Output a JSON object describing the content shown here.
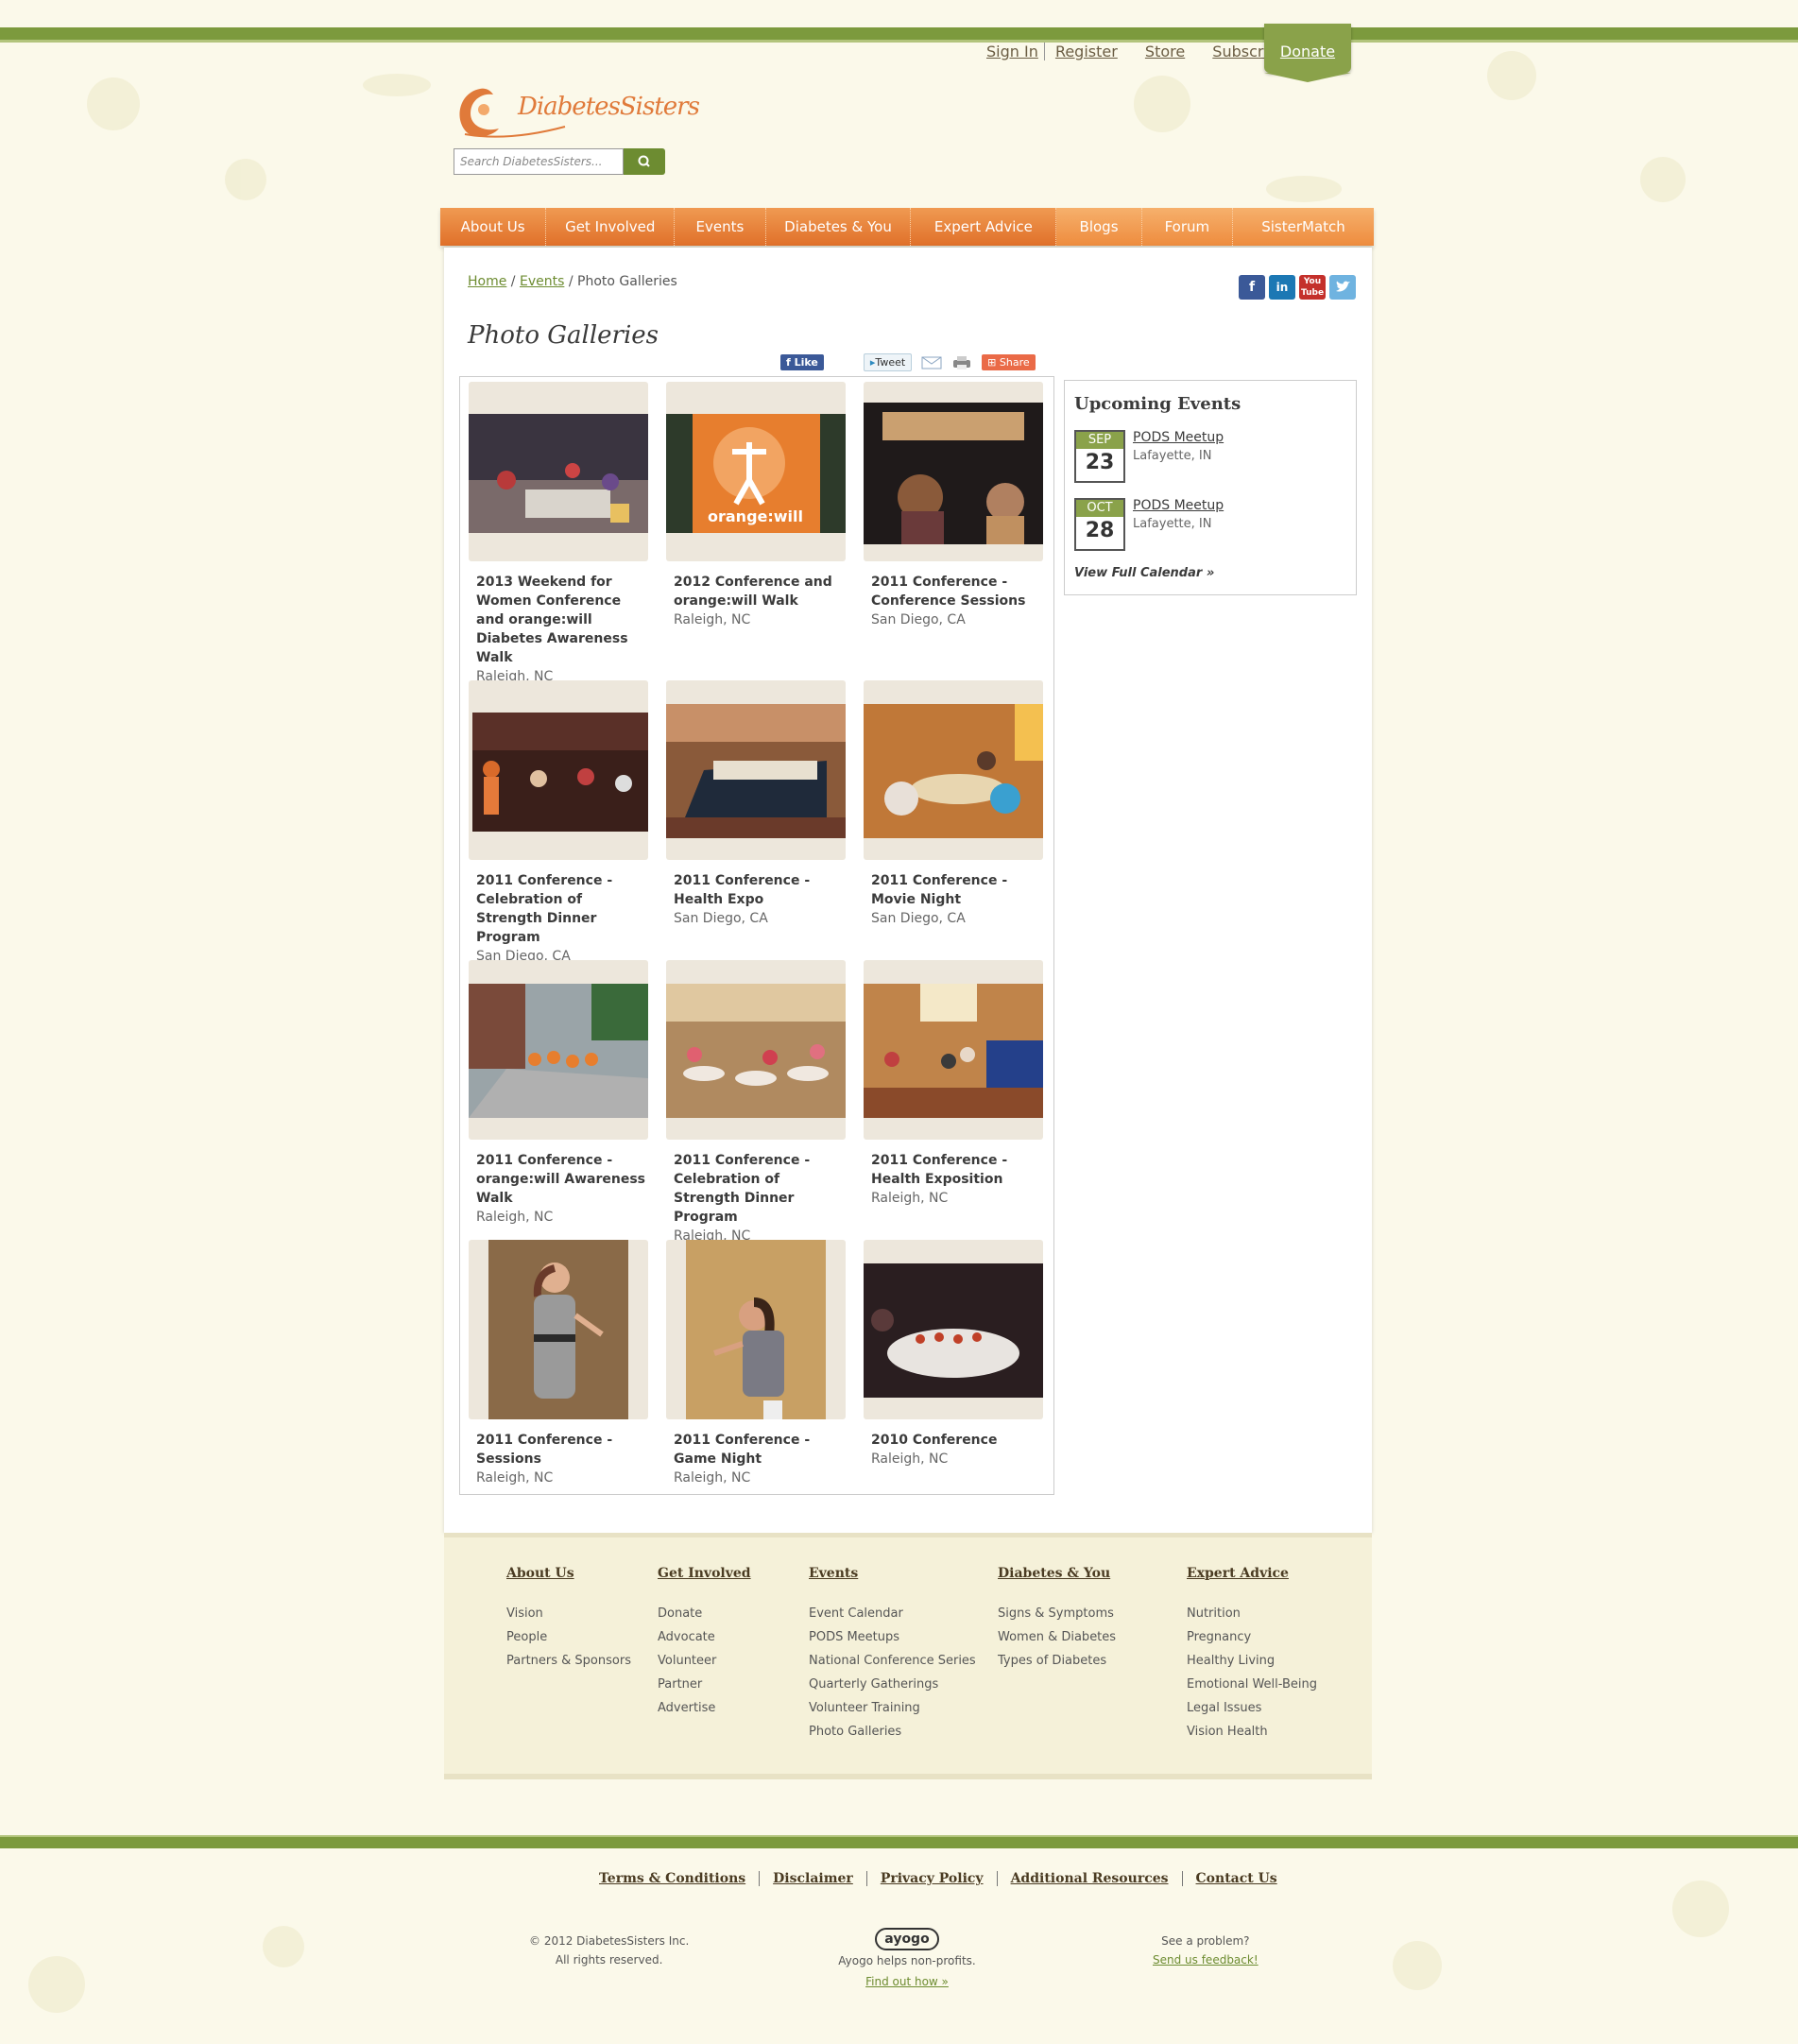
{
  "util_nav": {
    "sign_in": "Sign In",
    "register": "Register",
    "store": "Store",
    "subscribe": "Subscribe",
    "donate": "Donate"
  },
  "brand": {
    "name": "DiabetesSisters",
    "accent": "#e0702a",
    "green": "#7c9a3d"
  },
  "search": {
    "placeholder": "Search DiabetesSisters..."
  },
  "main_nav": [
    "About Us",
    "Get Involved",
    "Events",
    "Diabetes & You",
    "Expert Advice",
    "Blogs",
    "Forum",
    "SisterMatch"
  ],
  "breadcrumb": {
    "home": "Home",
    "events": "Events",
    "current": "Photo Galleries"
  },
  "page_title": "Photo Galleries",
  "share": {
    "like": "Like",
    "tweet": "Tweet",
    "share": "Share"
  },
  "galleries": [
    {
      "title": "2013 Weekend for Women Conference and orange:will Diabetes Awareness Walk",
      "location": "Raleigh, NC"
    },
    {
      "title": "2012 Conference and orange:will Walk",
      "location": "Raleigh, NC"
    },
    {
      "title": "2011 Conference - Conference Sessions",
      "location": "San Diego, CA"
    },
    {
      "title": "2011 Conference - Celebration of Strength Dinner Program",
      "location": "San Diego, CA"
    },
    {
      "title": "2011 Conference - Health Expo",
      "location": "San Diego, CA"
    },
    {
      "title": "2011 Conference - Movie Night",
      "location": "San Diego, CA"
    },
    {
      "title": "2011 Conference - orange:will Awareness Walk",
      "location": "Raleigh, NC"
    },
    {
      "title": "2011 Conference - Celebration of Strength Dinner Program",
      "location": "Raleigh, NC"
    },
    {
      "title": "2011 Conference - Health Exposition",
      "location": "Raleigh, NC"
    },
    {
      "title": "2011 Conference - Sessions",
      "location": "Raleigh, NC"
    },
    {
      "title": "2011 Conference - Game Night",
      "location": "Raleigh, NC"
    },
    {
      "title": "2010 Conference",
      "location": "Raleigh, NC"
    }
  ],
  "upcoming": {
    "heading": "Upcoming Events",
    "events": [
      {
        "month": "SEP",
        "day": "23",
        "title": "PODS Meetup",
        "location": "Lafayette, IN"
      },
      {
        "month": "OCT",
        "day": "28",
        "title": "PODS Meetup",
        "location": "Lafayette, IN"
      }
    ],
    "view_all": "View Full Calendar »"
  },
  "footer_cols": [
    {
      "heading": "About Us",
      "items": [
        "Vision",
        "People",
        "Partners & Sponsors"
      ]
    },
    {
      "heading": "Get Involved",
      "items": [
        "Donate",
        "Advocate",
        "Volunteer",
        "Partner",
        "Advertise"
      ]
    },
    {
      "heading": "Events",
      "items": [
        "Event Calendar",
        "PODS Meetups",
        "National Conference Series",
        "Quarterly Gatherings",
        "Volunteer Training",
        "Photo Galleries"
      ]
    },
    {
      "heading": "Diabetes & You",
      "items": [
        "Signs & Symptoms",
        "Women & Diabetes",
        "Types of Diabetes"
      ]
    },
    {
      "heading": "Expert Advice",
      "items": [
        "Nutrition",
        "Pregnancy",
        "Healthy Living",
        "Emotional Well-Being",
        "Legal Issues",
        "Vision Health"
      ]
    }
  ],
  "legal_links": [
    "Terms & Conditions",
    "Disclaimer",
    "Privacy Policy",
    "Additional Resources",
    "Contact Us"
  ],
  "copyright": {
    "line1": "© 2012 DiabetesSisters Inc.",
    "line2": "All rights reserved."
  },
  "ayogo": {
    "logo": "ayogo",
    "line1": "Ayogo helps non-profits.",
    "link": "Find out how »"
  },
  "feedback": {
    "line1": "See a problem?",
    "link": "Send us feedback!"
  }
}
